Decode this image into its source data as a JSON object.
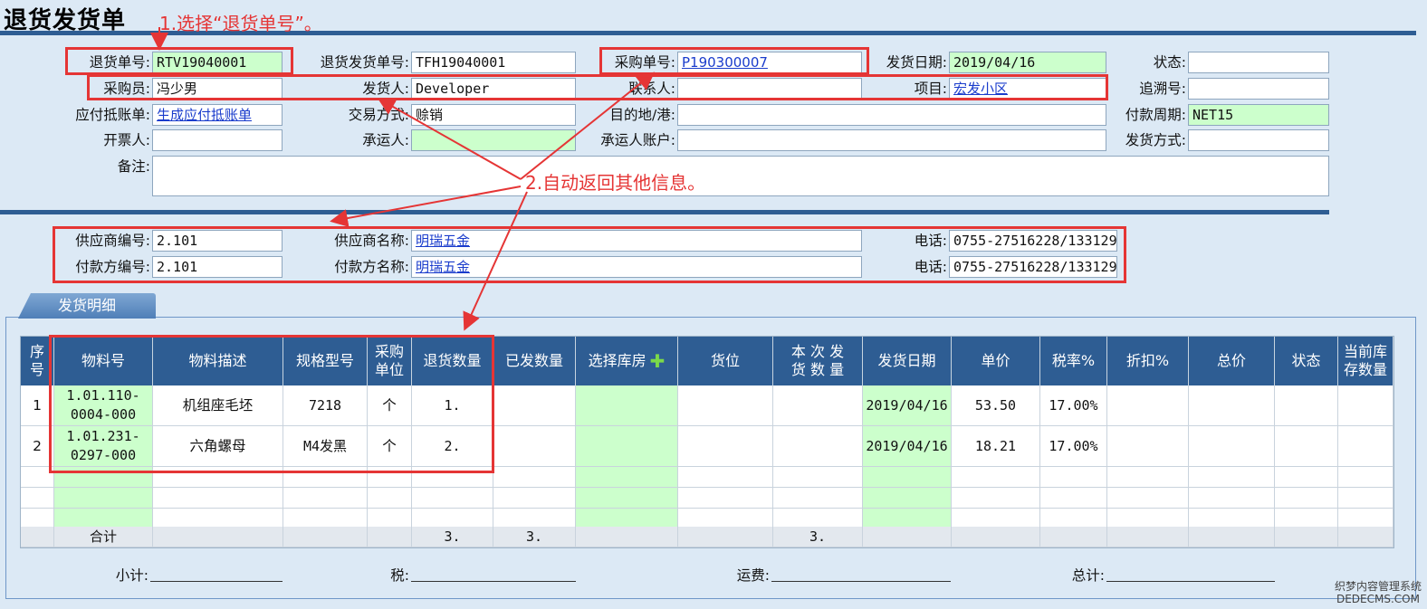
{
  "title": "退货发货单",
  "annotations": {
    "step1": "1.选择“退货单号”。",
    "step2": "2.自动返回其他信息。"
  },
  "header": {
    "return_no": {
      "label": "退货单号:",
      "value": "RTV19040001"
    },
    "return_ship_no": {
      "label": "退货发货单号:",
      "value": "TFH19040001"
    },
    "po_no": {
      "label": "采购单号:",
      "value": "P190300007"
    },
    "ship_date": {
      "label": "发货日期:",
      "value": "2019/04/16"
    },
    "status": {
      "label": "状态:",
      "value": ""
    },
    "buyer": {
      "label": "采购员:",
      "value": "冯少男"
    },
    "shipper": {
      "label": "发货人:",
      "value": "Developer"
    },
    "contact": {
      "label": "联系人:",
      "value": ""
    },
    "project": {
      "label": "项目:",
      "value": "宏发小区"
    },
    "trace_no": {
      "label": "追溯号:",
      "value": ""
    },
    "ap_offset": {
      "label": "应付抵账单:",
      "value": "生成应付抵账单"
    },
    "trade_method": {
      "label": "交易方式:",
      "value": "赊销"
    },
    "destination": {
      "label": "目的地/港:",
      "value": ""
    },
    "pay_period": {
      "label": "付款周期:",
      "value": "NET15"
    },
    "invoicer": {
      "label": "开票人:",
      "value": ""
    },
    "carrier": {
      "label": "承运人:",
      "value": ""
    },
    "carrier_account": {
      "label": "承运人账户:",
      "value": ""
    },
    "ship_method": {
      "label": "发货方式:",
      "value": ""
    },
    "remark": {
      "label": "备注:",
      "value": ""
    }
  },
  "supplier": {
    "supplier_no": {
      "label": "供应商编号:",
      "value": "2.101"
    },
    "supplier_name": {
      "label": "供应商名称:",
      "value": "明瑞五金"
    },
    "supplier_phone": {
      "label": "电话:",
      "value": "0755-27516228/133129"
    },
    "payer_no": {
      "label": "付款方编号:",
      "value": "2.101"
    },
    "payer_name": {
      "label": "付款方名称:",
      "value": "明瑞五金"
    },
    "payer_phone": {
      "label": "电话:",
      "value": "0755-27516228/133129"
    }
  },
  "detail_tab": "发货明细",
  "table": {
    "columns": [
      "序号",
      "物料号",
      "物料描述",
      "规格型号",
      "采购单位",
      "退货数量",
      "已发数量",
      "选择库房",
      "货位",
      "本次发货数量",
      "发货日期",
      "单价",
      "税率%",
      "折扣%",
      "总价",
      "状态",
      "当前库存数量"
    ],
    "column_display": [
      "序\n号",
      "物料号",
      "物料描述",
      "规格型号",
      "采购\n单位",
      "退货数量",
      "已发数量",
      "选择库房",
      "货位",
      "本 次 发\n货 数 量",
      "发货日期",
      "单价",
      "税率%",
      "折扣%",
      "总价",
      "状态",
      "当前库\n存数量"
    ],
    "rows": [
      [
        "1",
        "1.01.110-\n0004-000",
        "机组座毛坯",
        "7218",
        "个",
        "1.",
        "",
        "",
        "",
        "",
        "2019/04/16",
        "53.50",
        "17.00%",
        "",
        "",
        "",
        ""
      ],
      [
        "2",
        "1.01.231-\n0297-000",
        "六角螺母",
        "M4发黑",
        "个",
        "2.",
        "",
        "",
        "",
        "",
        "2019/04/16",
        "18.21",
        "17.00%",
        "",
        "",
        "",
        ""
      ]
    ],
    "footer": [
      "",
      "合计",
      "",
      "",
      "",
      "3.",
      "3.",
      "",
      "",
      "3.",
      "",
      "",
      "",
      "",
      "",
      "",
      ""
    ]
  },
  "totals": {
    "subtotal": "小计:",
    "tax": "税:",
    "freight": "运费:",
    "total": "总计:"
  },
  "watermark": {
    "line1": "织梦内容管理系统",
    "line2": "DEDECMS.COM"
  },
  "colors": {
    "accent": "#2e5d93",
    "highlight": "#ccffcc",
    "annotation": "#e53535",
    "link": "#1a3ccc"
  }
}
